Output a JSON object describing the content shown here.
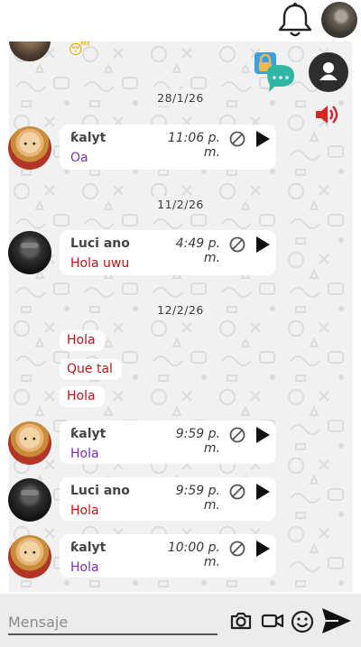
{
  "header": {
    "bell_icon": "bell-icon",
    "avatar": "profile-photo"
  },
  "chat_controls": {
    "lock_chat_icon": "lock-chat-icon",
    "profile_icon": "user-icon",
    "speaker_icon": "speaker-icon"
  },
  "partial_emoji": "😴",
  "dates": [
    "28/1/26",
    "11/2/26",
    "12/2/26"
  ],
  "messages": [
    {
      "user": "ƙalyt",
      "time": "11:06 p. m.",
      "text": "Oa",
      "color": "#7b2db3"
    },
    {
      "user": "Luci ano",
      "time": "4:49 p. m.",
      "text": "Hola uwu",
      "color": "#c31313"
    },
    {
      "user": "ƙalyt",
      "time": "9:59 p. m.",
      "text": "Hola",
      "color": "#7b2db3"
    },
    {
      "user": "Luci ano",
      "time": "9:59 p. m.",
      "text": "Hola",
      "color": "#c31313"
    },
    {
      "user": "ƙalyt",
      "time": "10:00 p. m.",
      "text": "Hola",
      "color": "#7b2db3"
    }
  ],
  "plain_messages": [
    "Hola",
    "Que tal",
    "Hola"
  ],
  "composer": {
    "placeholder": "Mensaje",
    "camera_icon": "camera-icon",
    "video_icon": "video-icon",
    "emoji_icon": "emoji-icon",
    "send_icon": "send-icon"
  }
}
